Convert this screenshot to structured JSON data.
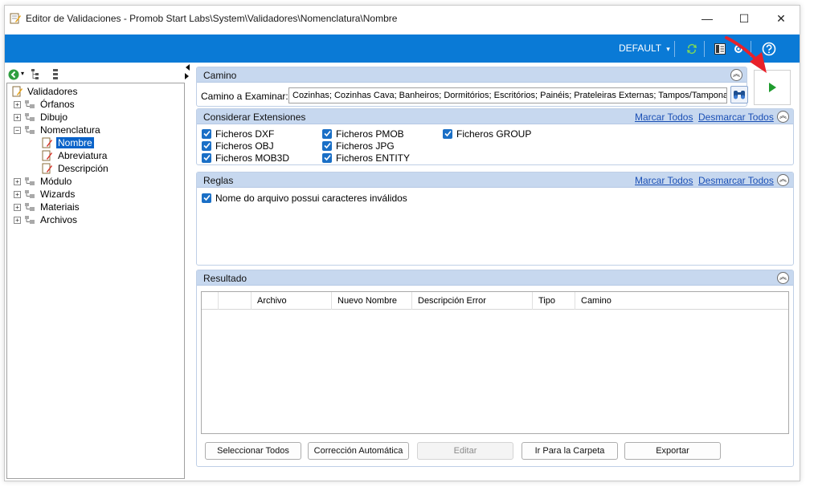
{
  "window": {
    "title": "Editor de Validaciones - Promob Start Labs\\System\\Validadores\\Nomenclatura\\Nombre",
    "minimize": "—",
    "maximize": "☐",
    "close": "✕"
  },
  "toolbar": {
    "profile": "DEFAULT",
    "profile_caret": "▾"
  },
  "tree": {
    "items": [
      {
        "label": "Validadores"
      },
      {
        "label": "Órfanos"
      },
      {
        "label": "Dibujo"
      },
      {
        "label": "Nomenclatura"
      },
      {
        "label": "Nombre"
      },
      {
        "label": "Abreviatura"
      },
      {
        "label": "Descripción"
      },
      {
        "label": "Módulo"
      },
      {
        "label": "Wizards"
      },
      {
        "label": "Materiais"
      },
      {
        "label": "Archivos"
      }
    ]
  },
  "camino": {
    "title": "Camino",
    "label": "Camino a Examinar:",
    "value": "Cozinhas; Cozinhas Cava; Banheiros; Dormitórios; Escritórios; Painéis; Prateleiras Externas; Tampos/Tamponamentos"
  },
  "extensiones": {
    "title": "Considerar Extensiones",
    "mark_all": "Marcar Todos",
    "unmark_all": "Desmarcar Todos",
    "items": [
      "Ficheros DXF",
      "Ficheros OBJ",
      "Ficheros MOB3D",
      "Ficheros PMOB",
      "Ficheros JPG",
      "Ficheros ENTITY",
      "Ficheros GROUP"
    ]
  },
  "reglas": {
    "title": "Reglas",
    "mark_all": "Marcar Todos",
    "unmark_all": "Desmarcar Todos",
    "items": [
      "Nome do arquivo possui caracteres inválidos"
    ]
  },
  "resultado": {
    "title": "Resultado",
    "columns": [
      "Archivo",
      "Nuevo Nombre",
      "Descripción Error",
      "Tipo",
      "Camino"
    ],
    "buttons": {
      "select_all": "Seleccionar Todos",
      "auto_fix": "Corrección Automática",
      "edit": "Editar",
      "go_folder": "Ir Para la Carpeta",
      "export": "Exportar"
    }
  },
  "colors": {
    "toolbar_blue": "#0a7ad6",
    "panel_header": "#c7d8ef",
    "checkbox": "#1a6fc6",
    "link": "#1a4fb5",
    "selection": "#0a63c9",
    "annotation_arrow": "#e8212a",
    "run_green": "#1f9b2e"
  }
}
